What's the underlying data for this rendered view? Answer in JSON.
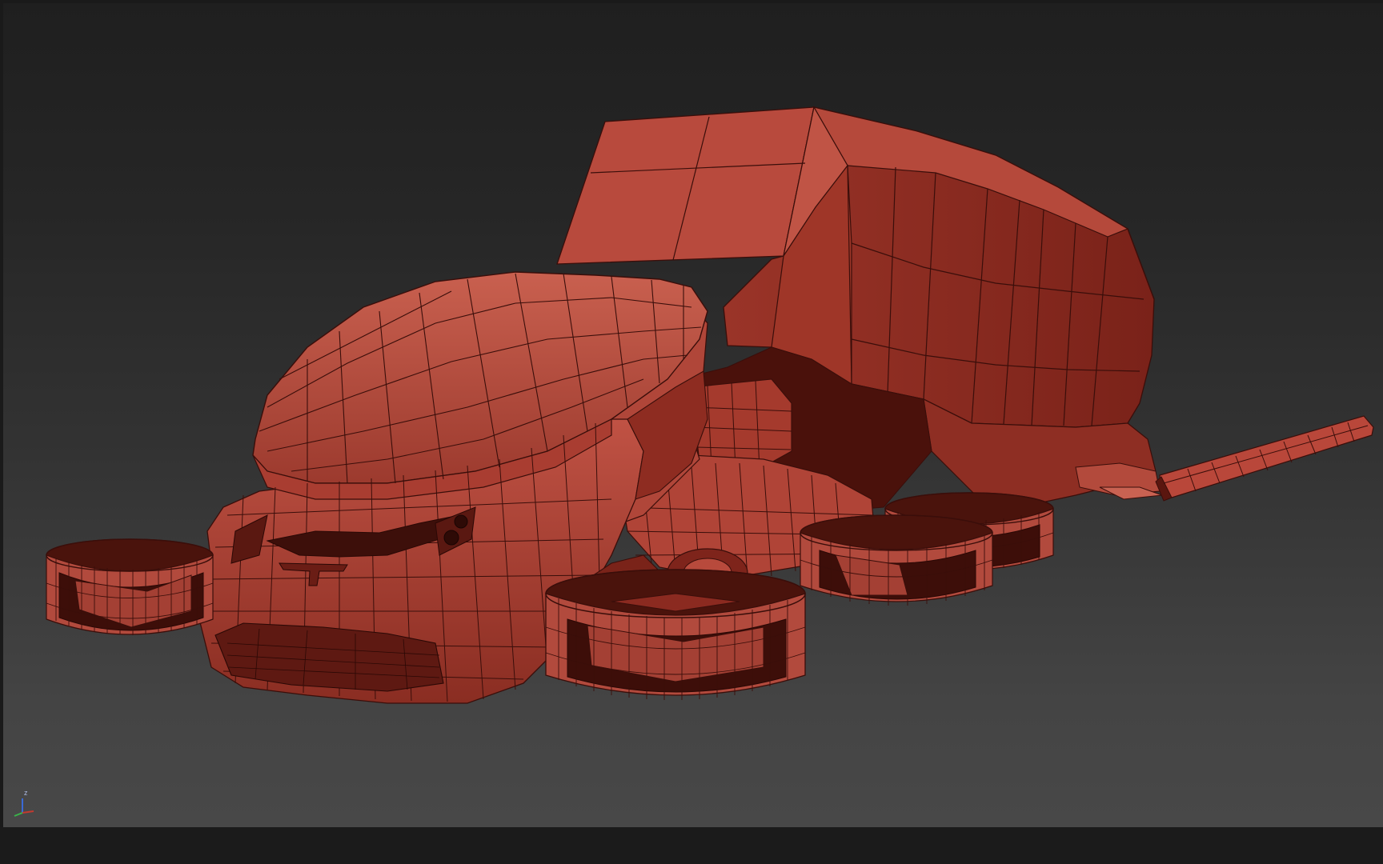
{
  "viewport": {
    "name": "3d-perspective-viewport",
    "model": "flying-car-truck-wireframe",
    "display_mode": "shaded-with-edged-faces",
    "colors": {
      "background_top": "#1f1f1f",
      "background_bottom": "#484848",
      "model_base": "#b24a3d",
      "model_light": "#c85a4b",
      "model_shadow": "#6e241c",
      "model_dark": "#3a0d09",
      "wire": "#3a0e0a",
      "frame": "#1b1b1b"
    }
  },
  "axis_gizmo": {
    "icon": "xyz-axis-gizmo-icon",
    "z_label": "z",
    "colors": {
      "x": "#c33a30",
      "y": "#3ab34a",
      "z": "#3a6ad6"
    }
  }
}
